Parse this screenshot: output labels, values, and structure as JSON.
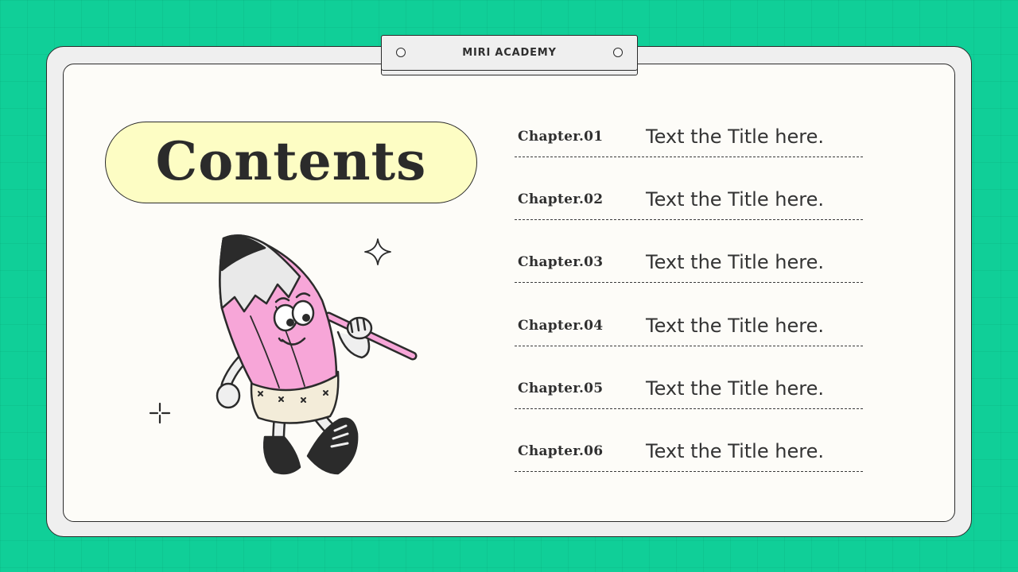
{
  "header": {
    "brand": "MIRI ACADEMY"
  },
  "title": "Contents",
  "chapters": [
    {
      "label": "Chapter.01",
      "title": "Text the Title here."
    },
    {
      "label": "Chapter.02",
      "title": "Text the Title here."
    },
    {
      "label": "Chapter.03",
      "title": "Text the Title here."
    },
    {
      "label": "Chapter.04",
      "title": "Text the Title here."
    },
    {
      "label": "Chapter.05",
      "title": "Text the Title here."
    },
    {
      "label": "Chapter.06",
      "title": "Text the Title here."
    }
  ],
  "colors": {
    "background": "#10cf98",
    "board": "#fdfcf8",
    "frame": "#efefef",
    "pill": "#fdfdc4",
    "pencil_pink": "#f7a6d8",
    "ink": "#2b2b2b"
  },
  "icons": [
    "pencil-mascot-illustration",
    "sparkle-icon",
    "plus-sparkle-icon"
  ]
}
